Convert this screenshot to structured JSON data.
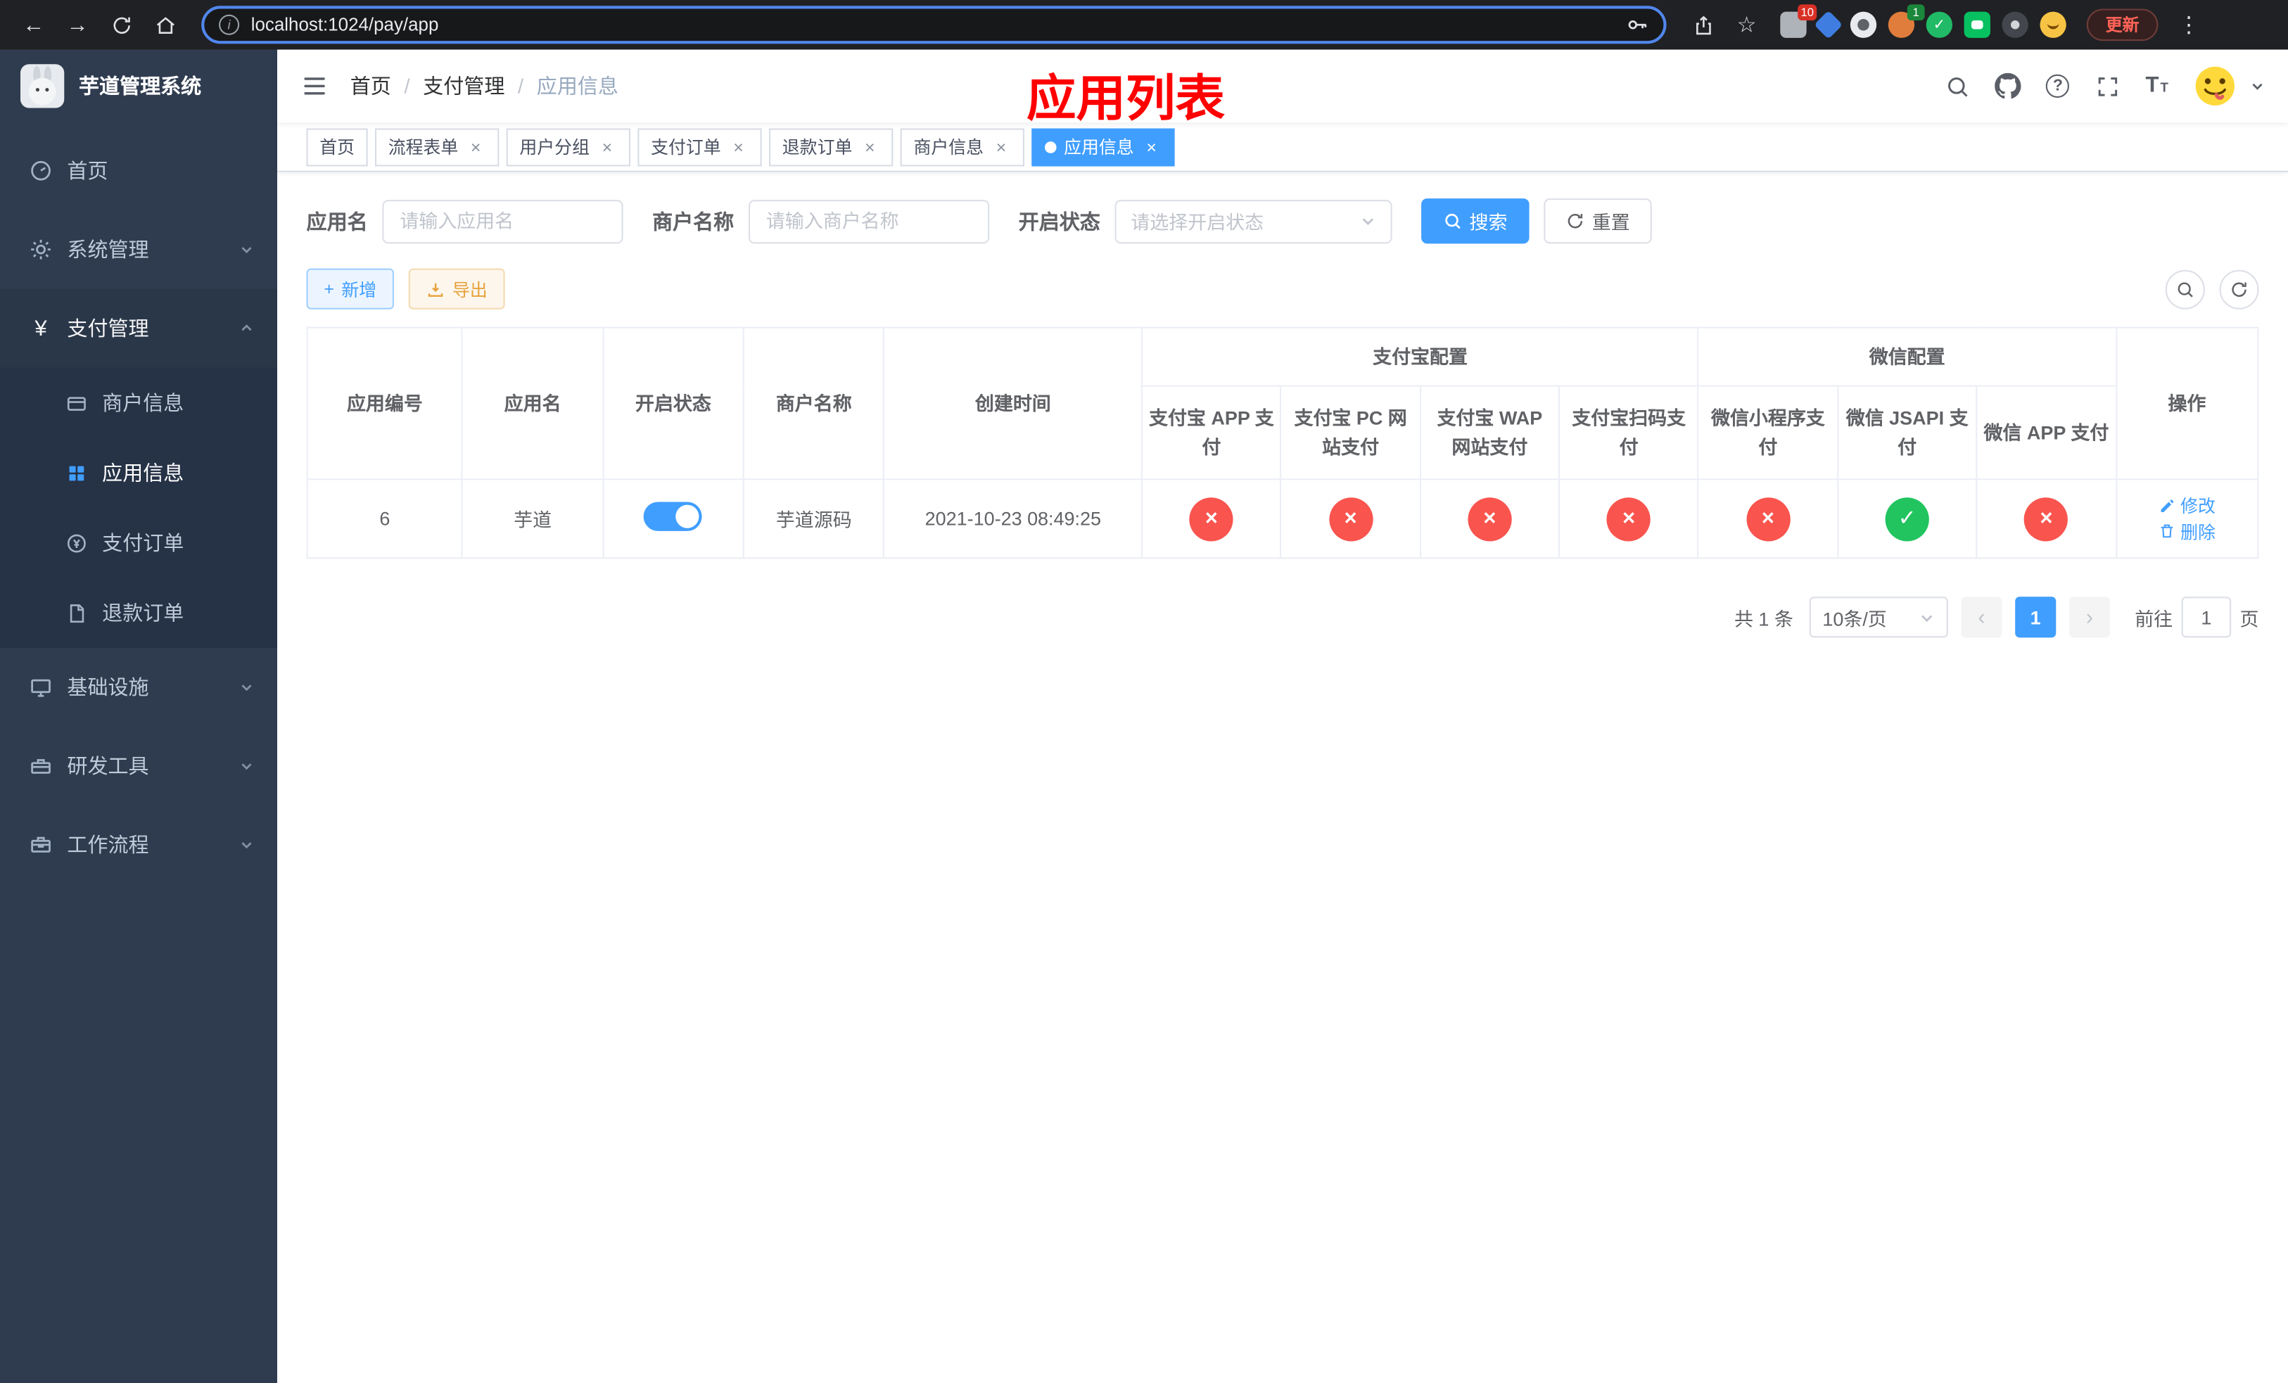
{
  "icons": {
    "close": "×",
    "check": "✓",
    "back": "←",
    "forward": "→",
    "star": "☆",
    "menu_dots": "⋮",
    "prev": "‹",
    "next": "›",
    "breadcrumb_sep": "/",
    "plus": "+",
    "info": "i",
    "question": "?",
    "yen": "¥",
    "font_large": "T",
    "font_small": "T"
  },
  "colors": {
    "accent": "#409eff",
    "danger": "#f9544e",
    "success": "#21c45f",
    "warning": "#e6a23c",
    "annotation": "#ff0000"
  },
  "browser": {
    "url": "localhost:1024/pay/app",
    "update_label": "更新",
    "extension_badge_red": "10",
    "extension_badge_green": "1"
  },
  "sidebar": {
    "app_title": "芋道管理系统",
    "items": [
      {
        "label": "首页"
      },
      {
        "label": "系统管理"
      },
      {
        "label": "支付管理"
      },
      {
        "label": "商户信息"
      },
      {
        "label": "应用信息"
      },
      {
        "label": "支付订单"
      },
      {
        "label": "退款订单"
      },
      {
        "label": "基础设施"
      },
      {
        "label": "研发工具"
      },
      {
        "label": "工作流程"
      }
    ]
  },
  "header": {
    "breadcrumb": [
      "首页",
      "支付管理",
      "应用信息"
    ],
    "annotation": "应用列表"
  },
  "tabs": [
    {
      "label": "首页"
    },
    {
      "label": "流程表单"
    },
    {
      "label": "用户分组"
    },
    {
      "label": "支付订单"
    },
    {
      "label": "退款订单"
    },
    {
      "label": "商户信息"
    },
    {
      "label": "应用信息"
    }
  ],
  "filters": {
    "app_name_label": "应用名",
    "app_name_placeholder": "请输入应用名",
    "merchant_label": "商户名称",
    "merchant_placeholder": "请输入商户名称",
    "status_label": "开启状态",
    "status_placeholder": "请选择开启状态",
    "search_label": "搜索",
    "reset_label": "重置"
  },
  "toolbar": {
    "add_label": "新增",
    "export_label": "导出"
  },
  "table": {
    "columns": {
      "app_id": "应用编号",
      "app_name": "应用名",
      "status": "开启状态",
      "merchant": "商户名称",
      "created": "创建时间",
      "alipay_group": "支付宝配置",
      "wechat_group": "微信配置",
      "alipay_app": "支付宝 APP 支付",
      "alipay_pc": "支付宝 PC 网站支付",
      "alipay_wap": "支付宝 WAP 网站支付",
      "alipay_qr": "支付宝扫码支付",
      "wechat_mini": "微信小程序支付",
      "wechat_jsapi": "微信 JSAPI 支付",
      "wechat_app": "微信 APP 支付",
      "actions": "操作"
    },
    "rows": [
      {
        "app_id": "6",
        "app_name": "芋道",
        "toggle_class": "switch on",
        "merchant": "芋道源码",
        "created": "2021-10-23 08:49:25",
        "alipay_app": {
          "symbol": "×",
          "class": "cfg-circle danger"
        },
        "alipay_pc": {
          "symbol": "×",
          "class": "cfg-circle danger"
        },
        "alipay_wap": {
          "symbol": "×",
          "class": "cfg-circle danger"
        },
        "alipay_qr": {
          "symbol": "×",
          "class": "cfg-circle danger"
        },
        "wechat_mini": {
          "symbol": "×",
          "class": "cfg-circle danger"
        },
        "wechat_jsapi": {
          "symbol": "✓",
          "class": "cfg-circle success"
        },
        "wechat_app": {
          "symbol": "×",
          "class": "cfg-circle danger"
        },
        "edit_label": "修改",
        "delete_label": "删除"
      }
    ]
  },
  "pagination": {
    "total": "共 1 条",
    "page_size": "10条/页",
    "current_page": "1",
    "goto_label": "前往",
    "goto_value": "1",
    "page_unit": "页"
  }
}
